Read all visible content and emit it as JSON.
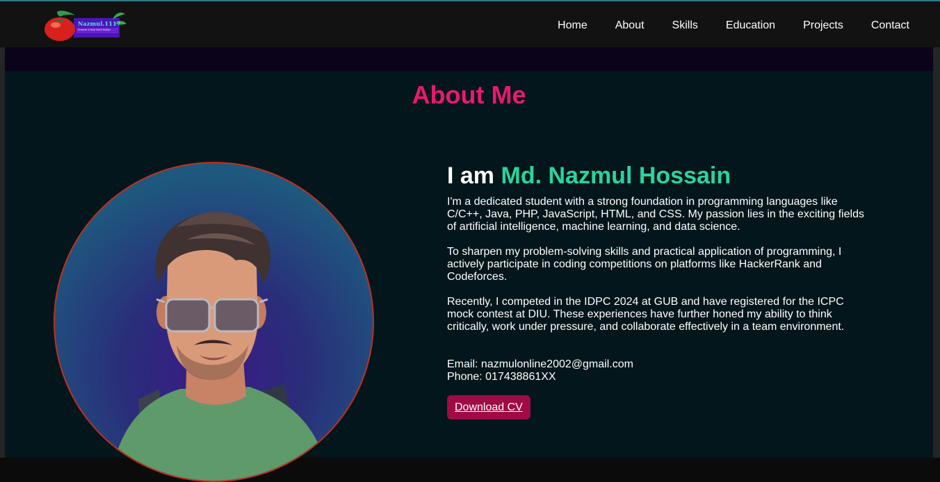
{
  "brand": {
    "logo_text": "Nazmul.1117",
    "logo_tagline": "Dreamer & Real World Builder"
  },
  "nav": {
    "items": [
      {
        "label": "Home"
      },
      {
        "label": "About"
      },
      {
        "label": "Skills"
      },
      {
        "label": "Education"
      },
      {
        "label": "Projects"
      },
      {
        "label": "Contact"
      }
    ]
  },
  "about": {
    "title": "About Me",
    "intro_prefix": "I am",
    "name": "Md. Nazmul Hossain",
    "paragraphs": [
      "I'm a dedicated student with a strong foundation in programming languages like C/C++, Java, PHP, JavaScript, HTML, and CSS. My passion lies in the exciting fields of artificial intelligence, machine learning, and data science.",
      "To sharpen my problem-solving skills and practical application of programming, I actively participate in coding competitions on platforms like HackerRank and Codeforces.",
      "Recently, I competed in the IDPC 2024 at GUB and have registered for the ICPC mock contest at DIU. These experiences have further honed my ability to think critically, work under pressure, and collaborate effectively in a team environment."
    ],
    "email": "Email: nazmulonline2002@gmail.com",
    "phone": "Phone: 017438861XX",
    "download_label": "Download CV",
    "profile_image": "avatar-illustration"
  },
  "colors": {
    "accent_pink": "#e9196f",
    "accent_green": "#2ad39d",
    "button_bg": "#a00a45",
    "section_bg": "#03161b",
    "navbar_bg": "#121212"
  }
}
